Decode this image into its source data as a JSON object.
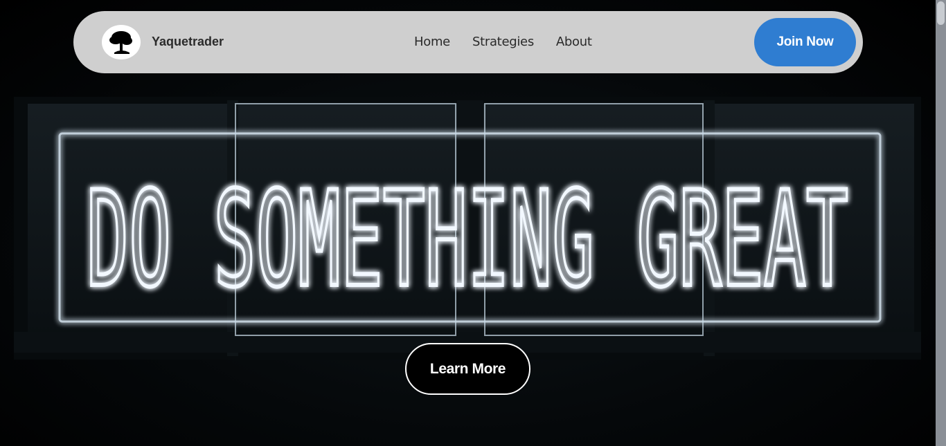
{
  "nav": {
    "brand": "Yaquetrader",
    "links": [
      "Home",
      "Strategies",
      "About"
    ],
    "join_label": "Join Now"
  },
  "hero": {
    "neon_text": "DO SOMETHING GREAT",
    "learn_label": "Learn More"
  },
  "colors": {
    "accent": "#2f7dd1",
    "navbar_bg": "#cfcfcf",
    "neon": "#eef6ff"
  },
  "icons": {
    "logo": "tree-icon"
  }
}
